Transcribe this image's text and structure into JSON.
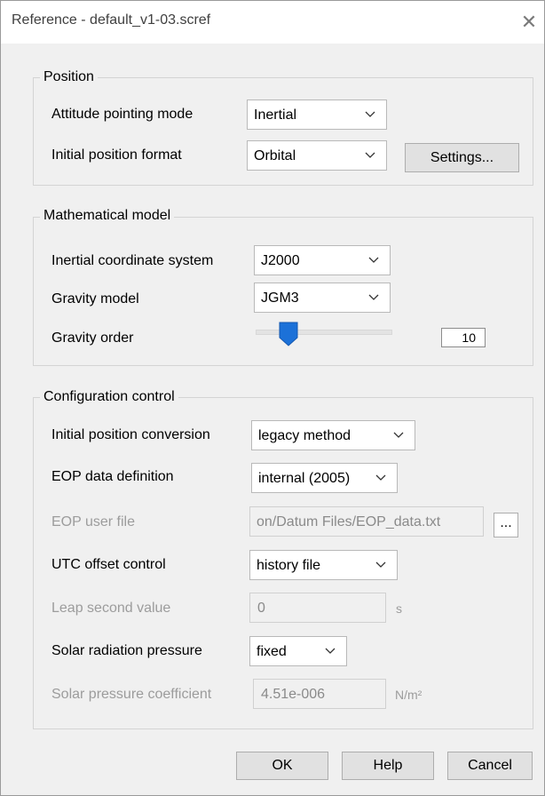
{
  "window": {
    "title": "Reference - default_v1-03.scref",
    "close_glyph": "✕"
  },
  "position": {
    "legend": "Position",
    "attitude_label": "Attitude pointing mode",
    "attitude_value": "Inertial",
    "initial_format_label": "Initial position format",
    "initial_format_value": "Orbital",
    "settings_button": "Settings..."
  },
  "math_model": {
    "legend": "Mathematical model",
    "coord_system_label": "Inertial coordinate system",
    "coord_system_value": "J2000",
    "gravity_model_label": "Gravity model",
    "gravity_model_value": "JGM3",
    "gravity_order_label": "Gravity order",
    "gravity_order_value": "10",
    "gravity_order_slider_fraction": 0.24
  },
  "config_control": {
    "legend": "Configuration control",
    "init_conv_label": "Initial position conversion",
    "init_conv_value": "legacy method",
    "eop_def_label": "EOP data definition",
    "eop_def_value": "internal (2005)",
    "eop_file_label": "EOP user file",
    "eop_file_value": "on/Datum Files/EOP_data.txt",
    "browse_button": "...",
    "utc_label": "UTC offset control",
    "utc_value": "history file",
    "leap_label": "Leap second value",
    "leap_value": "0",
    "leap_unit": "s",
    "srp_label": "Solar radiation pressure",
    "srp_value": "fixed",
    "spc_label": "Solar pressure coefficient",
    "spc_value": "4.51e-006",
    "spc_unit": "N/m²"
  },
  "buttons": {
    "ok": "OK",
    "help": "Help",
    "cancel": "Cancel"
  },
  "icons": {
    "close": "close-icon",
    "dropdown": "chevron-down-icon",
    "slider": "slider-thumb"
  },
  "colors": {
    "window_bg": "#f0f0f0",
    "slider_thumb": "#1c71d8",
    "border": "#d4d4d4"
  }
}
